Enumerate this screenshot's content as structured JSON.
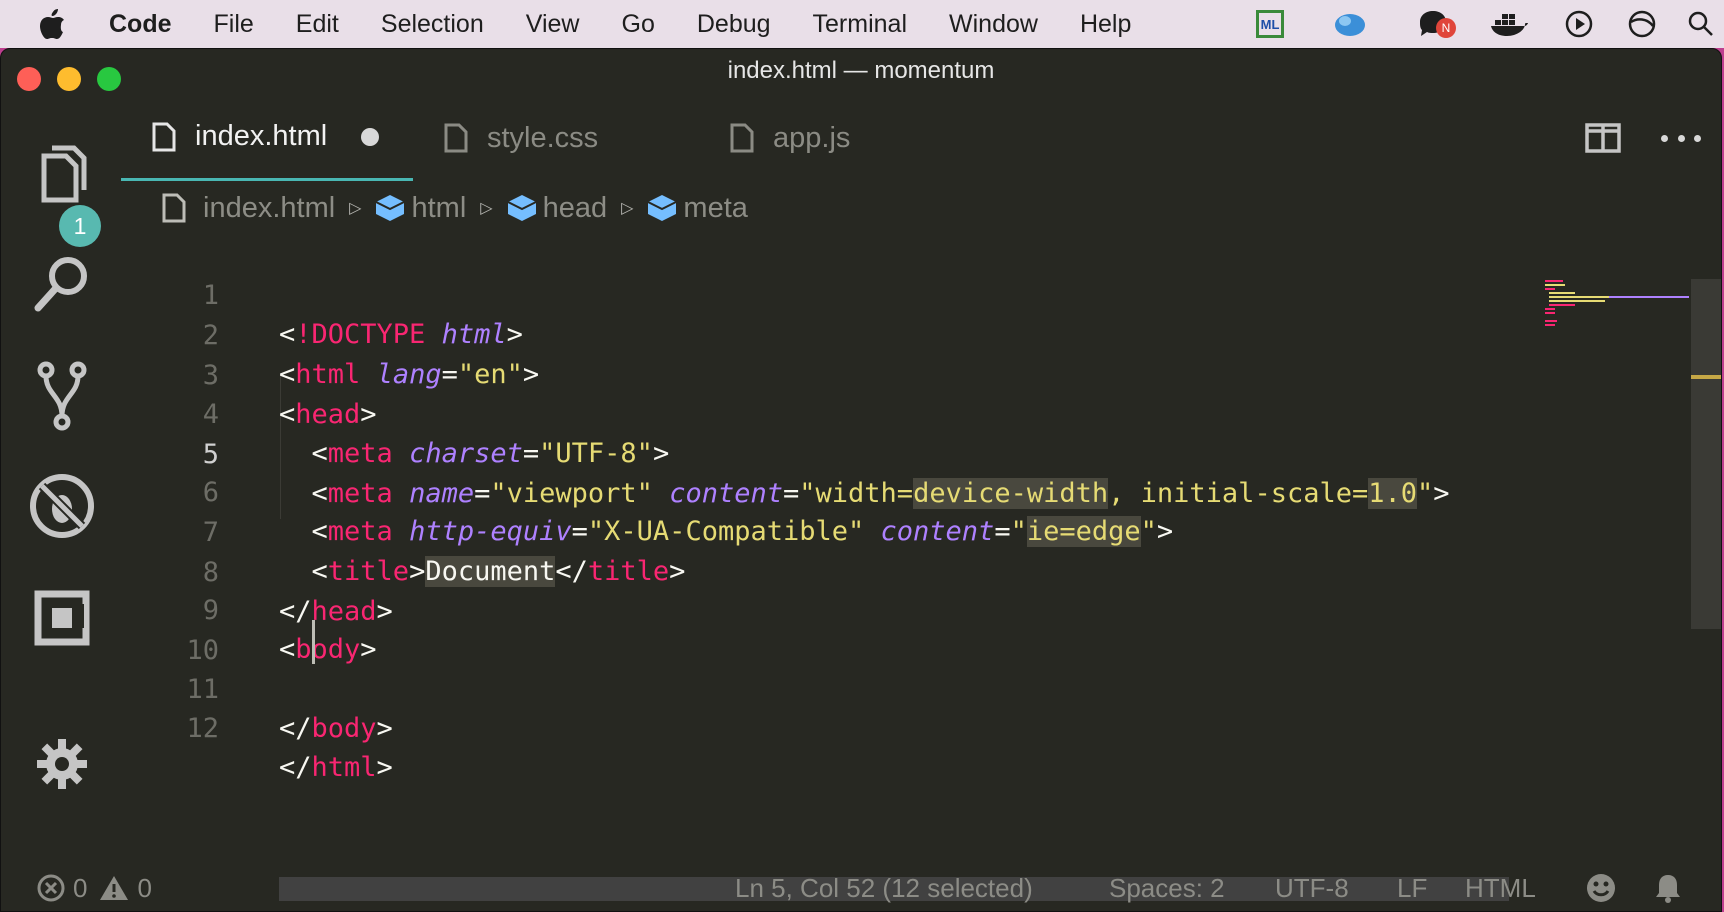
{
  "menubar": {
    "app_name": "Code",
    "items": [
      "File",
      "Edit",
      "Selection",
      "View",
      "Go",
      "Debug",
      "Terminal",
      "Window",
      "Help"
    ],
    "tray_icons": [
      "ml-icon",
      "cloud-icon",
      "chat-bubble-icon",
      "docker-icon",
      "play-circle-icon",
      "sync-circle-icon",
      "search-icon"
    ],
    "ml_label": "ML",
    "notification_letter": "N"
  },
  "window": {
    "title": "index.html — momentum"
  },
  "activity_bar": {
    "explorer_badge": "1",
    "icons": [
      "files-icon",
      "search-icon",
      "source-control-icon",
      "debug-icon",
      "extensions-icon",
      "gear-icon"
    ]
  },
  "tabs": [
    {
      "label": "index.html",
      "active": true,
      "dirty": true
    },
    {
      "label": "style.css",
      "active": false,
      "dirty": false
    },
    {
      "label": "app.js",
      "active": false,
      "dirty": false
    }
  ],
  "breadcrumbs": [
    "index.html",
    "html",
    "head",
    "meta"
  ],
  "editor": {
    "language": "HTML",
    "lines": [
      {
        "n": "1",
        "text": "<!DOCTYPE html>"
      },
      {
        "n": "2",
        "text": "<html lang=\"en\">"
      },
      {
        "n": "3",
        "text": "<head>"
      },
      {
        "n": "4",
        "text": "  <meta charset=\"UTF-8\">"
      },
      {
        "n": "5",
        "text": "  <meta name=\"viewport\" content=\"width=device-width, initial-scale=1.0\">"
      },
      {
        "n": "6",
        "text": "  <meta http-equiv=\"X-UA-Compatible\" content=\"ie=edge\">"
      },
      {
        "n": "7",
        "text": "  <title>Document</title>"
      },
      {
        "n": "8",
        "text": "</head>"
      },
      {
        "n": "9",
        "text": "<body>"
      },
      {
        "n": "10",
        "text": "  "
      },
      {
        "n": "11",
        "text": "</body>"
      },
      {
        "n": "12",
        "text": "</html>"
      }
    ],
    "current_line": "5"
  },
  "statusbar": {
    "errors": "0",
    "warnings": "0",
    "position": "Ln 5, Col 52 (12 selected)",
    "spaces": "Spaces: 2",
    "encoding": "UTF-8",
    "eol": "LF",
    "language": "HTML"
  },
  "colors": {
    "editor_bg": "#272822",
    "tag": "#f92672",
    "attribute": "#ae81ff",
    "string": "#e6db74",
    "badge": "#58b9b0",
    "active_tab_border": "#49b7b3"
  }
}
